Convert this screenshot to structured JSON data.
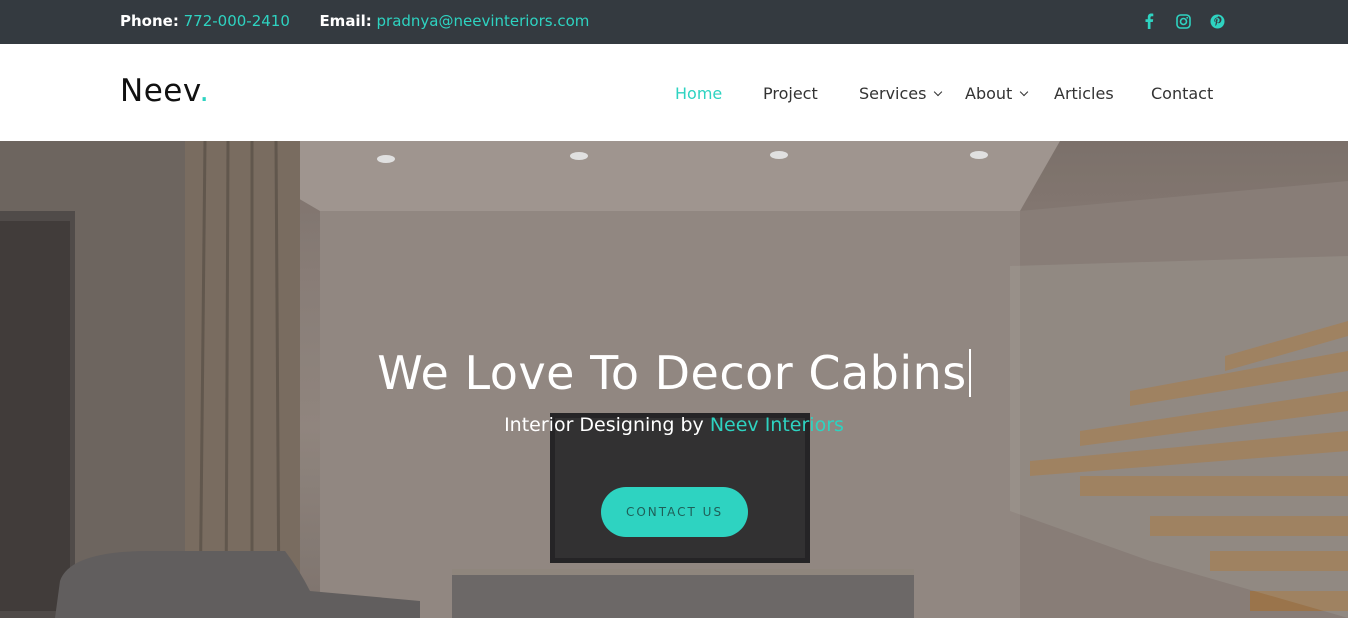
{
  "topbar": {
    "phone_label": "Phone:",
    "phone_value": "772-000-2410",
    "email_label": "Email:",
    "email_value": "pradnya@neevinteriors.com",
    "socials": [
      "facebook-icon",
      "instagram-icon",
      "pinterest-icon"
    ]
  },
  "nav": {
    "logo": "Neev",
    "logo_dot": ".",
    "items": [
      {
        "label": "Home",
        "active": true
      },
      {
        "label": "Project"
      },
      {
        "label": "Services",
        "dropdown": true
      },
      {
        "label": "About",
        "dropdown": true
      },
      {
        "label": "Articles"
      },
      {
        "label": "Contact"
      }
    ]
  },
  "hero": {
    "title": "We Love To Decor Cabins",
    "subtitle_prefix": "Interior Designing by",
    "subtitle_brand": "Neev Interiors",
    "cta_label": "CONTACT US"
  },
  "colors": {
    "accent": "#2ed3c1",
    "topbar_bg": "#343a40",
    "nav_text": "#333333"
  }
}
